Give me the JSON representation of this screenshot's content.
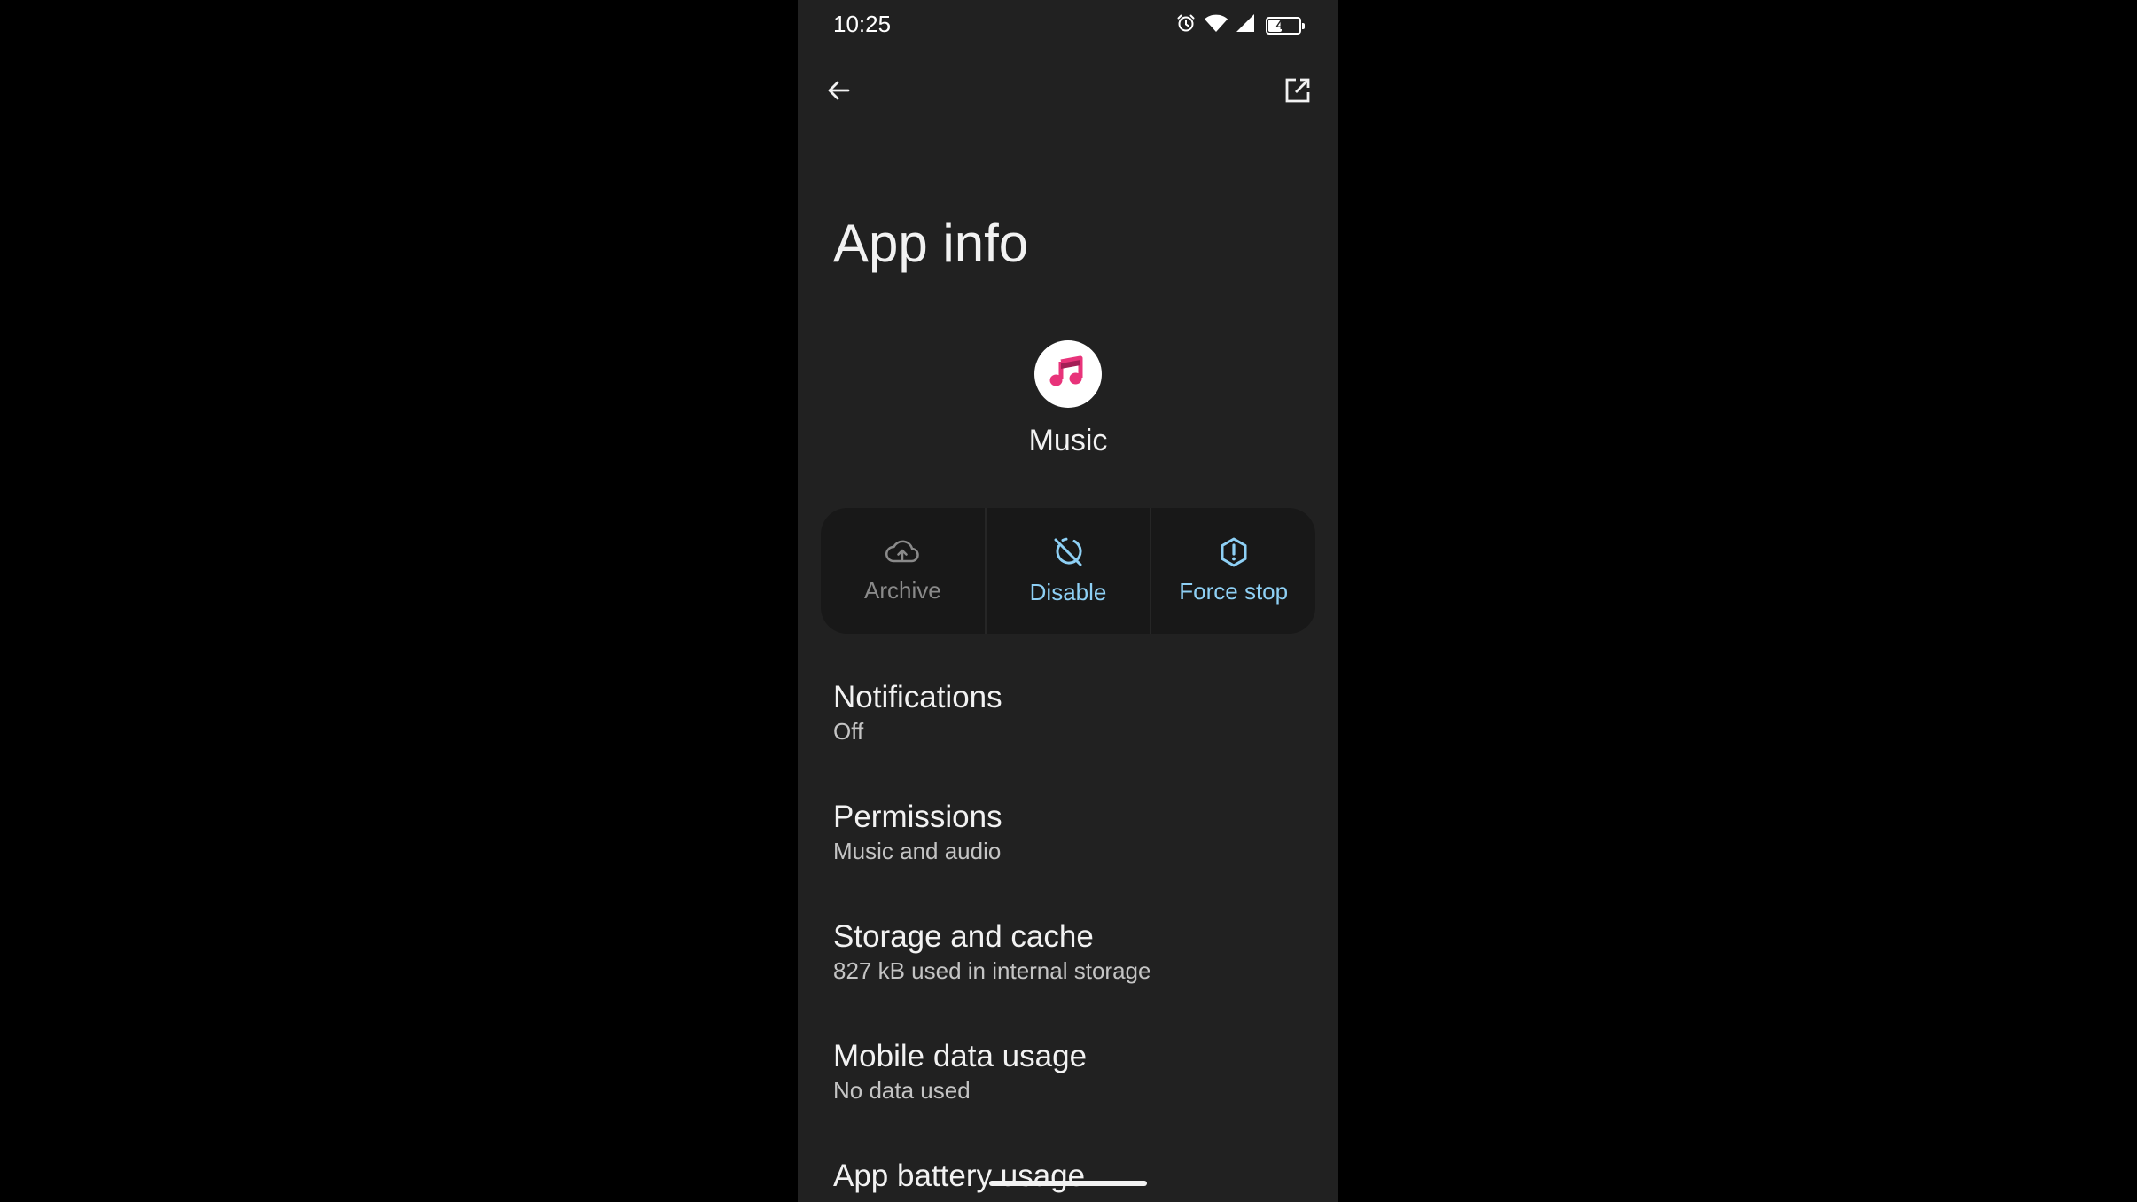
{
  "status_bar": {
    "time": "10:25",
    "battery_level": "42",
    "icons": [
      "alarm-icon",
      "wifi-icon",
      "signal-icon",
      "battery-icon"
    ]
  },
  "toolbar": {
    "back_icon": "back-arrow-icon",
    "open_icon": "open-in-new-icon"
  },
  "page": {
    "title": "App info"
  },
  "app": {
    "name": "Music",
    "icon": "music-note-icon",
    "icon_color": "#e8337a"
  },
  "actions": [
    {
      "label": "Archive",
      "icon": "cloud-upload-icon",
      "enabled": false
    },
    {
      "label": "Disable",
      "icon": "disable-icon",
      "enabled": true
    },
    {
      "label": "Force stop",
      "icon": "alert-circle-icon",
      "enabled": true
    }
  ],
  "settings": [
    {
      "title": "Notifications",
      "subtitle": "Off"
    },
    {
      "title": "Permissions",
      "subtitle": "Music and audio"
    },
    {
      "title": "Storage and cache",
      "subtitle": "827 kB used in internal storage"
    },
    {
      "title": "Mobile data usage",
      "subtitle": "No data used"
    },
    {
      "title": "App battery usage",
      "subtitle": ""
    }
  ],
  "colors": {
    "background": "#212121",
    "accent": "#8ed0f5",
    "disabled": "#8a8a8a"
  }
}
